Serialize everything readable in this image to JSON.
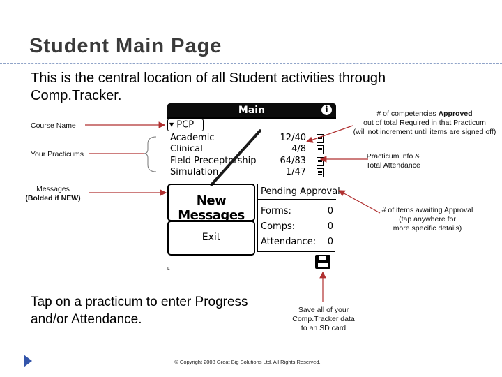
{
  "slide": {
    "title": "Student Main Page",
    "intro": "This is the central location of all Student activities through Comp.Tracker.",
    "bottom_text": "Tap on a practicum to enter Progress and/or Attendance.",
    "copyright": "© Copyright 2008 Great Big Solutions Ltd. All Rights Reserved."
  },
  "annotations": {
    "course_name": "Course Name",
    "your_practicums": "Your Practicums",
    "messages_line1": "Messages",
    "messages_line2": "(Bolded if NEW)",
    "competencies_pre": "# of competencies ",
    "competencies_bold": "Approved",
    "competencies_line2": "out of total Required in that Practicum",
    "competencies_line3": "(will not increment until items are signed off)",
    "practicum_info_line1": "Practicum info &",
    "practicum_info_line2": "Total Attendance",
    "awaiting_line1": "# of items awaiting Approval",
    "awaiting_line2": "(tap anywhere for",
    "awaiting_line3": "more specific details)",
    "save_line1": "Save all of your",
    "save_line2": "Comp.Tracker data",
    "save_line3": "to an SD card"
  },
  "palm": {
    "title": "Main",
    "info_icon": "i",
    "course": "PCP",
    "practicums": [
      {
        "name": "Academic",
        "count": "12/40"
      },
      {
        "name": "Clinical",
        "count": "4/8"
      },
      {
        "name": "Field Preceptorship",
        "count": "64/83"
      },
      {
        "name": "Simulation",
        "count": "1/47"
      }
    ],
    "messages_button": "New Messages",
    "exit_button": "Exit",
    "pending": {
      "title": "Pending Approval",
      "rows": [
        {
          "label": "Forms:",
          "value": "0"
        },
        {
          "label": "Comps:",
          "value": "0"
        },
        {
          "label": "Attendance:",
          "value": "0"
        }
      ]
    },
    "tiny_mark": "L"
  },
  "colors": {
    "arrow": "#b03030",
    "dash": "#8fa3c8",
    "bullet": "#3355aa"
  }
}
